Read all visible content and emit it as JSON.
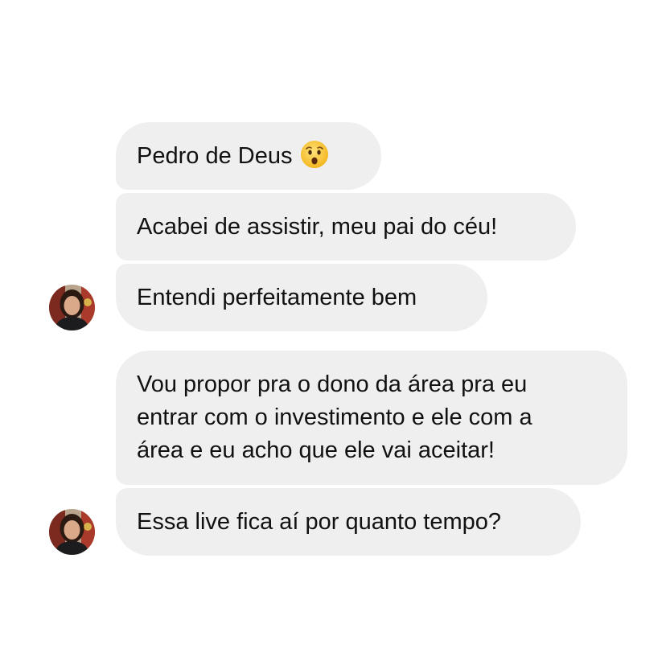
{
  "conversation": {
    "messages": [
      {
        "text": "Pedro de Deus",
        "emoji": "astonished-face-icon"
      },
      {
        "text": "Acabei de assistir, meu pai do céu!"
      },
      {
        "text": "Entendi perfeitamente bem"
      },
      {
        "lines": [
          "Vou propor pra o dono da área pra eu",
          "entrar com o investimento e ele com a",
          "área e eu acho que ele vai aceitar!"
        ]
      },
      {
        "text": "Essa live fica aí por quanto tempo?"
      }
    ]
  },
  "colors": {
    "bubble_background": "#efefef",
    "page_background": "#ffffff",
    "text": "#111111"
  }
}
